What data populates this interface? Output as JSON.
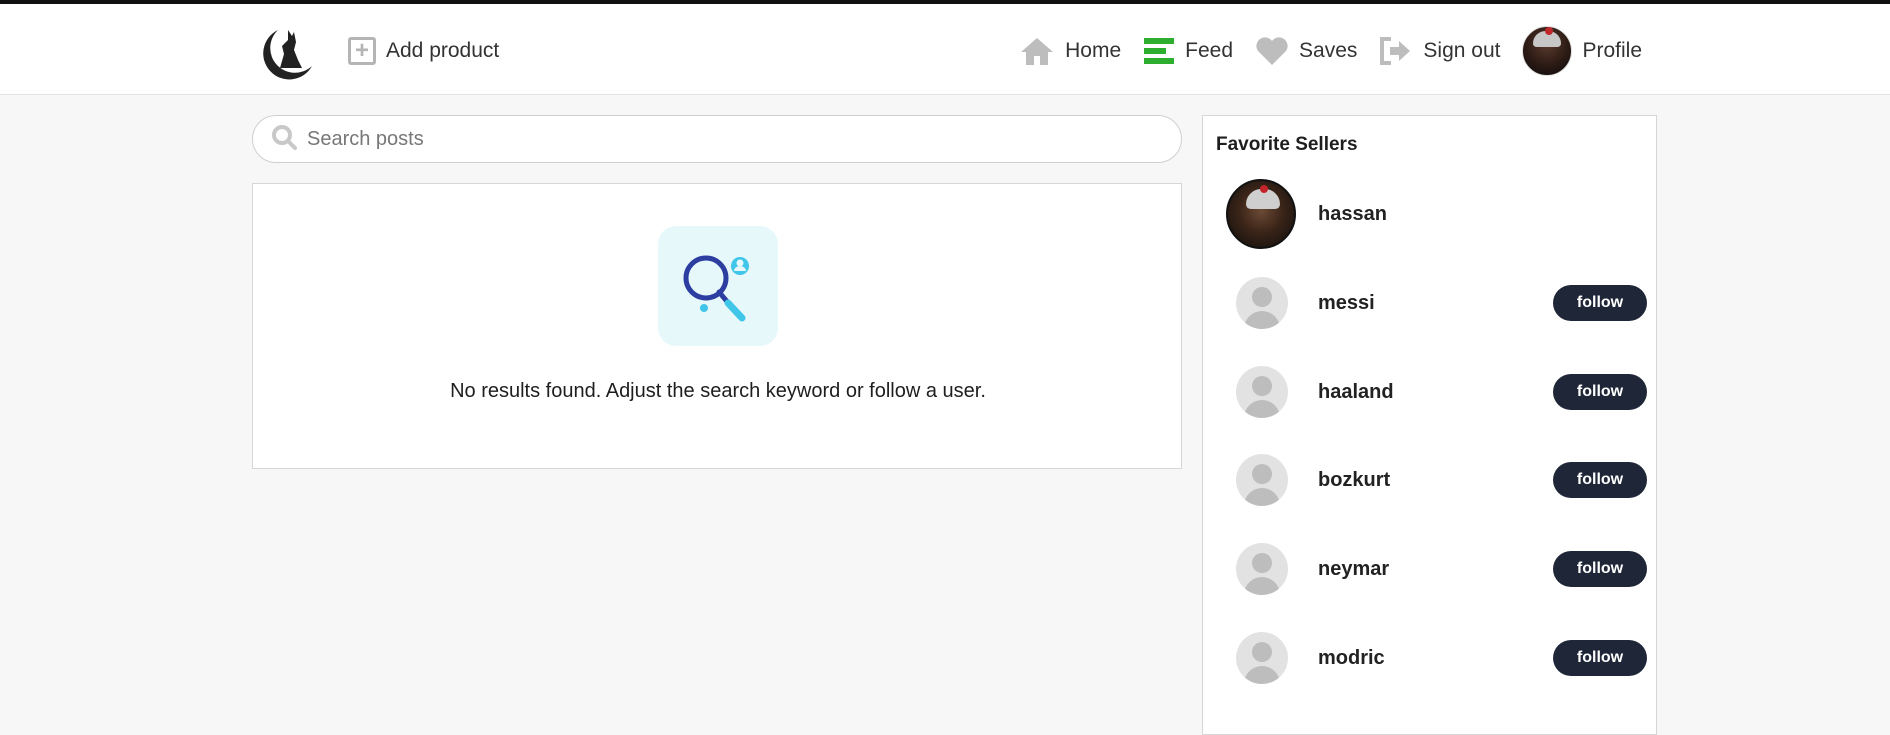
{
  "navbar": {
    "add_product_label": "Add product",
    "items": [
      {
        "label": "Home",
        "icon": "home-icon"
      },
      {
        "label": "Feed",
        "icon": "feed-icon"
      },
      {
        "label": "Saves",
        "icon": "heart-icon"
      },
      {
        "label": "Sign out",
        "icon": "sign-out-icon"
      },
      {
        "label": "Profile",
        "icon": "profile-avatar"
      }
    ],
    "feed_color": "#2eae2e",
    "icon_color": "#bdbdbd"
  },
  "search": {
    "placeholder": "Search posts",
    "value": ""
  },
  "results": {
    "empty_message": "No results found. Adjust the search keyword or follow a user."
  },
  "sidebar": {
    "title": "Favorite Sellers",
    "sellers": [
      {
        "name": "hassan",
        "has_photo": true,
        "follow_label": ""
      },
      {
        "name": "messi",
        "has_photo": false,
        "follow_label": "follow"
      },
      {
        "name": "haaland",
        "has_photo": false,
        "follow_label": "follow"
      },
      {
        "name": "bozkurt",
        "has_photo": false,
        "follow_label": "follow"
      },
      {
        "name": "neymar",
        "has_photo": false,
        "follow_label": "follow"
      },
      {
        "name": "modric",
        "has_photo": false,
        "follow_label": "follow"
      }
    ]
  },
  "colors": {
    "follow_button_bg": "#1f2638",
    "page_bg": "#f7f7f7",
    "illustration_bg": "#e7f8fb"
  }
}
